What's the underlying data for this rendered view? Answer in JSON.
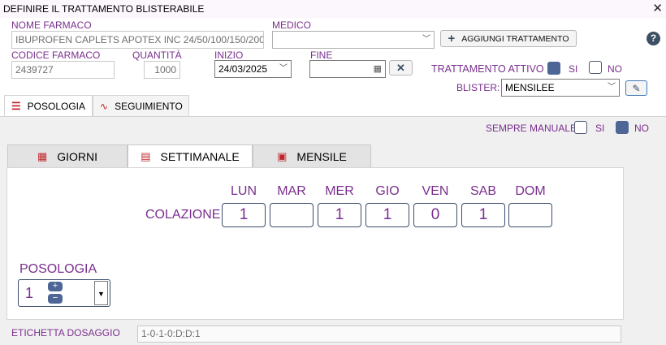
{
  "window": {
    "title": "DEFINIRE IL TRATTAMENTO BLISTERABILE"
  },
  "form": {
    "nome_farmaco": {
      "label": "NOME FARMACO",
      "value": "IBUPROFEN CAPLETS APOTEX INC 24/50/100/150/200"
    },
    "medico": {
      "label": "MEDICO",
      "value": ""
    },
    "add_button": "AGGIUNGI TRATTAMENTO",
    "codice_farmaco": {
      "label": "CODICE FARMACO",
      "value": "2439727"
    },
    "quantita": {
      "label": "QUANTITÀ",
      "value": "1000"
    },
    "inizio": {
      "label": "INIZIO",
      "value": "24/03/2025"
    },
    "fine": {
      "label": "FINE",
      "value": ""
    },
    "trattamento_attivo": {
      "label": "TRATTAMENTO ATTIVO",
      "si": "SI",
      "no": "NO",
      "selected": "SI"
    },
    "blister": {
      "label": "BLISTER:",
      "value": "MENSILEE"
    }
  },
  "tabs": {
    "posologia": "POSOLOGIA",
    "seguimento": "SEGUIMIENTO"
  },
  "sempre_manuale": {
    "label": "SEMPRE MANUALE",
    "si": "SI",
    "no": "NO",
    "selected": "NO"
  },
  "inner_tabs": {
    "giorni": "GIORNI",
    "settimanale": "SETTIMANALE",
    "mensile": "MENSILE",
    "active": "SETTIMANALE"
  },
  "weekly": {
    "row_label": "COLAZIONE",
    "days": [
      "LUN",
      "MAR",
      "MER",
      "GIO",
      "VEN",
      "SAB",
      "DOM"
    ],
    "values": [
      "1",
      "",
      "1",
      "1",
      "0",
      "1",
      ""
    ]
  },
  "posologia": {
    "label": "POSOLOGIA",
    "value": "1"
  },
  "etichetta": {
    "label": "ETICHETTA DOSAGGIO",
    "value": "1-0-1-0:D:D:1"
  },
  "colors": {
    "accent": "#7a2f8e",
    "checkbox_on": "#4e6696",
    "border_dark": "#3c4d6b"
  },
  "icons": [
    "close-icon",
    "plus-icon",
    "help-icon",
    "calendar-icon",
    "clear-icon",
    "pencil-icon",
    "list-icon",
    "pulse-icon",
    "grid-icon",
    "chevron-down-icon"
  ]
}
